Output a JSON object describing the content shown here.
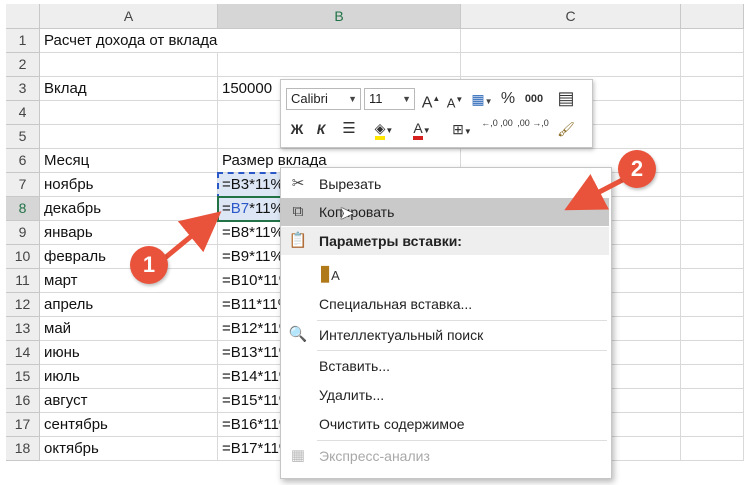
{
  "columns": {
    "a": "A",
    "b": "B",
    "c": "C"
  },
  "rows": [
    {
      "num": "1",
      "a": "Расчет дохода от вклада",
      "b": ""
    },
    {
      "num": "2",
      "a": "",
      "b": ""
    },
    {
      "num": "3",
      "a": "Вклад",
      "b": "150000"
    },
    {
      "num": "4",
      "a": "",
      "b": ""
    },
    {
      "num": "5",
      "a": "",
      "b": ""
    },
    {
      "num": "6",
      "a": "Месяц",
      "b": "Размер вклада"
    },
    {
      "num": "7",
      "a": "ноябрь",
      "b_ref": "=B3",
      "b_rest": "*11%"
    },
    {
      "num": "8",
      "a": "декабрь",
      "b_eq": "=",
      "b_ref": "B7",
      "b_rest": "*11%"
    },
    {
      "num": "9",
      "a": "январь",
      "b": "=B8*11%"
    },
    {
      "num": "10",
      "a": "февраль",
      "b": "=B9*11%"
    },
    {
      "num": "11",
      "a": "март",
      "b": "=B10*11%"
    },
    {
      "num": "12",
      "a": "апрель",
      "b": "=B11*11%"
    },
    {
      "num": "13",
      "a": "май",
      "b": "=B12*11%"
    },
    {
      "num": "14",
      "a": "июнь",
      "b": "=B13*11%"
    },
    {
      "num": "15",
      "a": "июль",
      "b": "=B14*11%"
    },
    {
      "num": "16",
      "a": "август",
      "b": "=B15*11%"
    },
    {
      "num": "17",
      "a": "сентябрь",
      "b": "=B16*11%"
    },
    {
      "num": "18",
      "a": "октябрь",
      "b": "=B17*11%"
    }
  ],
  "mini_toolbar": {
    "font_name": "Calibri",
    "font_size": "11",
    "bold": "Ж",
    "italic": "К",
    "percent": "%",
    "thousands": "000",
    "dec_inc": "←,0 ,00",
    "dec_dec": ",00 →,0"
  },
  "context_menu": {
    "cut": "Вырезать",
    "copy": "Копировать",
    "paste_options": "Параметры вставки:",
    "paste_special": "Специальная вставка...",
    "smart_lookup": "Интеллектуальный поиск",
    "insert": "Вставить...",
    "delete": "Удалить...",
    "clear": "Очистить содержимое",
    "quick_analysis": "Экспресс-анализ"
  },
  "badges": {
    "one": "1",
    "two": "2"
  },
  "colors": {
    "accent": "#217346",
    "badge": "#e9533b",
    "highlight": "#c9c9c9"
  }
}
